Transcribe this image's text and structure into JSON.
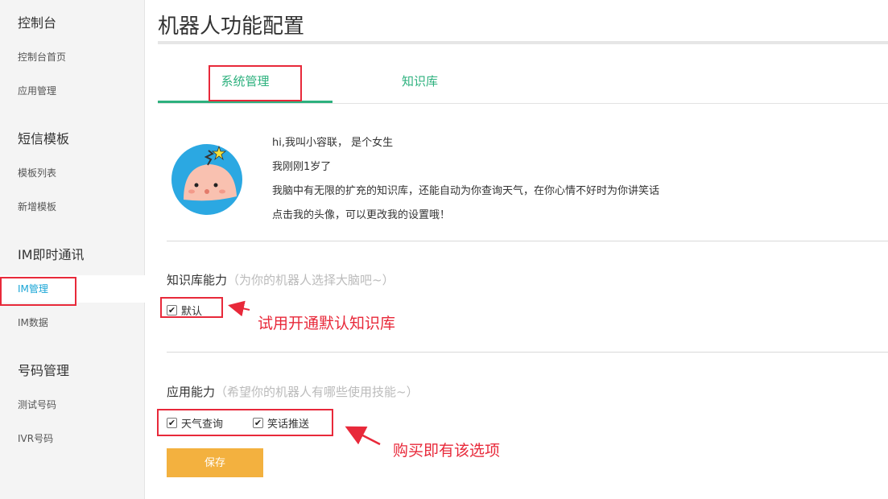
{
  "sidebar": {
    "sections": [
      {
        "title": "控制台",
        "items": [
          "控制台首页",
          "应用管理"
        ]
      },
      {
        "title": "短信模板",
        "items": [
          "模板列表",
          "新增模板"
        ]
      },
      {
        "title": "IM即时通讯",
        "items": [
          "IM管理",
          "IM数据"
        ]
      },
      {
        "title": "号码管理",
        "items": [
          "测试号码",
          "IVR号码"
        ]
      }
    ],
    "active_item": "IM管理"
  },
  "page": {
    "title": "机器人功能配置"
  },
  "tabs": [
    {
      "label": "系统管理",
      "active": true
    },
    {
      "label": "知识库",
      "active": false
    }
  ],
  "robot": {
    "avatar_icon": "robot-avatar-icon",
    "intro": [
      "hi,我叫小容联， 是个女生",
      "我刚刚1岁了",
      "我脑中有无限的扩充的知识库，还能自动为你查询天气，在你心情不好时为你讲笑话",
      "点击我的头像，可以更改我的设置哦！"
    ]
  },
  "knowledge": {
    "heading": "知识库能力",
    "hint": "（为你的机器人选择大脑吧~）",
    "options": [
      {
        "label": "默认",
        "checked": true
      }
    ]
  },
  "apps": {
    "heading": "应用能力",
    "hint": "（希望你的机器人有哪些使用技能~）",
    "options": [
      {
        "label": "天气查询",
        "checked": true
      },
      {
        "label": "笑话推送",
        "checked": true
      }
    ]
  },
  "save_label": "保存",
  "annotations": {
    "knowledge_note": "试用开通默认知识库",
    "apps_note": "购买即有该选项"
  },
  "colors": {
    "accent_green": "#2db17e",
    "active_blue": "#18a5d6",
    "save_orange": "#f3b13f",
    "annotation_red": "#e8293a"
  }
}
